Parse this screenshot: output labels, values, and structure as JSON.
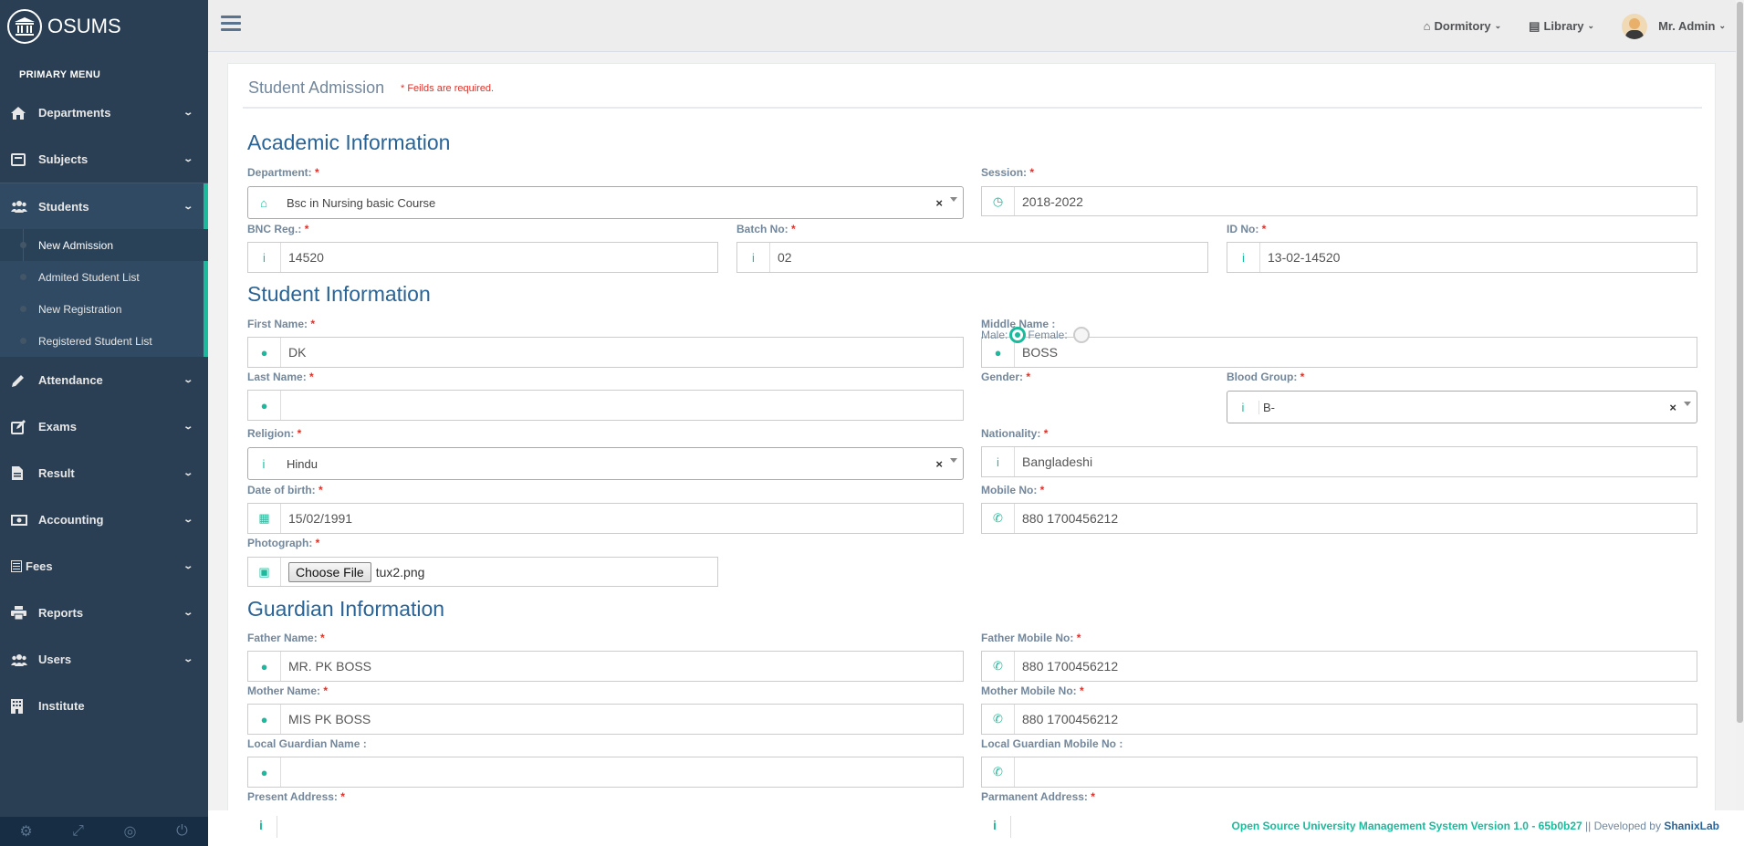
{
  "app": {
    "brand": "OSUMS"
  },
  "sidebar": {
    "heading": "PRIMARY MENU",
    "items": [
      {
        "label": "Departments",
        "icon": "home-icon"
      },
      {
        "label": "Subjects",
        "icon": "book-icon"
      },
      {
        "label": "Students",
        "icon": "users-icon"
      },
      {
        "label": "Attendance",
        "icon": "pencil-icon"
      },
      {
        "label": "Exams",
        "icon": "edit-icon"
      },
      {
        "label": "Result",
        "icon": "file-icon"
      },
      {
        "label": "Accounting",
        "icon": "money-icon"
      },
      {
        "label": "Fees",
        "icon": "list-icon"
      },
      {
        "label": "Reports",
        "icon": "print-icon"
      },
      {
        "label": "Users",
        "icon": "users-icon"
      },
      {
        "label": "Institute",
        "icon": "building-icon"
      }
    ],
    "students_sub": [
      "New Admission",
      "Admited Student List",
      "New Registration",
      "Registered Student List"
    ]
  },
  "topnav": {
    "dormitory": "Dormitory",
    "library": "Library",
    "user": "Mr. Admin"
  },
  "panel": {
    "title": "Student Admission",
    "note": "* Feilds are required."
  },
  "sections": {
    "academic": "Academic Information",
    "student": "Student Information",
    "guardian": "Guardian Information"
  },
  "labels": {
    "department": "Department:",
    "session": "Session:",
    "bnc": "BNC Reg.:",
    "batch": "Batch No:",
    "idno": "ID No:",
    "first": "First Name:",
    "middle": "Middle Name :",
    "last": "Last Name:",
    "gender": "Gender:",
    "male": "Male:",
    "female": "Female:",
    "blood": "Blood Group:",
    "religion": "Religion:",
    "nationality": "Nationality:",
    "dob": "Date of birth:",
    "mobile": "Mobile No:",
    "photo": "Photograph:",
    "father": "Father Name:",
    "father_mobile": "Father Mobile No:",
    "mother": "Mother Name:",
    "mother_mobile": "Mother Mobile No:",
    "lg_name": "Local Guardian Name :",
    "lg_mobile": "Local Guardian Mobile No :",
    "present": "Present Address:",
    "permanent": "Parmanent Address:"
  },
  "values": {
    "department": "Bsc in Nursing basic Course",
    "session": "2018-2022",
    "bnc": "14520",
    "batch": "02",
    "idno": "13-02-14520",
    "first": "DK",
    "middle": "BOSS",
    "last": "",
    "blood": "B-",
    "religion": "Hindu",
    "nationality": "Bangladeshi",
    "dob": "15/02/1991",
    "mobile": "880 1700456212",
    "photo_button": "Choose File",
    "photo_file": "tux2.png",
    "father": "MR. PK BOSS",
    "father_mobile": "880 1700456212",
    "mother": "MIS PK BOSS",
    "mother_mobile": "880 1700456212",
    "lg_name": "",
    "lg_mobile": ""
  },
  "footer": {
    "system": "Open Source University Management System Version 1.0 - 65b0b27",
    "sep": " || Developed by ",
    "dev": "ShanixLab"
  },
  "colors": {
    "accent": "#1abb9c",
    "sidebar": "#2a3f54",
    "heading": "#2a6496",
    "required": "#d9332b"
  }
}
